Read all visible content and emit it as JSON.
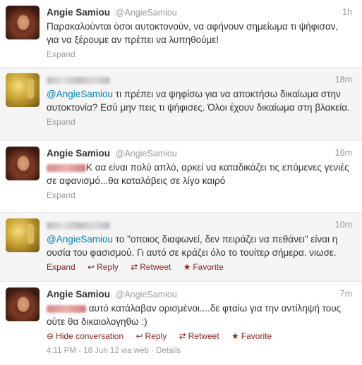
{
  "tweets": [
    {
      "fullname": "Angie Samiou",
      "username": "@AngieSamiou",
      "time": "1h",
      "text": "Παρακαλούνται όσοι αυτοκτονούν, να αφήνουν σημείωμα τι ψήφισαν, για να ξέρουμε αν πρέπει να λυπηθούμε!",
      "expand": "Expand"
    },
    {
      "time": "18m",
      "mention": "@AngieSamiou",
      "text": " τι πρέπει να ψηφίσω για να αποκτήσω δικαίωμα στην αυτοκτονία? Εσύ μην πεις τι ψήφισες. Όλοι έχουν δικαίωμα στη βλακεία.",
      "expand": "Expand"
    },
    {
      "fullname": "Angie Samiou",
      "username": "@AngieSamiou",
      "time": "16m",
      "text": "Κ αα είναι πολύ απλό, αρκεί να καταδικάζει τις επόμενες γενιές σε αφανισμό...θα καταλάβεις σε λίγο καιρό",
      "expand": "Expand"
    },
    {
      "time": "10m",
      "mention": "@AngieSamiou",
      "text": " το \"οποιος διαφωνεί, δεν πειράζει να πεθάνει\" είναι η ουσία του φασισμού. Γι αυτό σε κράζει όλο το τουίτερ σήμερα. νιωσε.",
      "actions": [
        "Expand",
        "Reply",
        "Retweet",
        "Favorite"
      ]
    },
    {
      "fullname": "Angie Samiou",
      "username": "@AngieSamiou",
      "time": "7m",
      "text": " αυτό κατάλαβαν ορισμένοι....δε φταίω για την αντίληψή τους ούτε θα δικαιολογηθω :)",
      "actions": [
        "Hide conversation",
        "Reply",
        "Retweet",
        "Favorite"
      ],
      "meta": "4:11 PM - 18 Jun 12 via web · Details"
    }
  ],
  "colors": {
    "link": "#0084b4",
    "action_dark": "#8a1f1f",
    "muted": "#999999"
  }
}
